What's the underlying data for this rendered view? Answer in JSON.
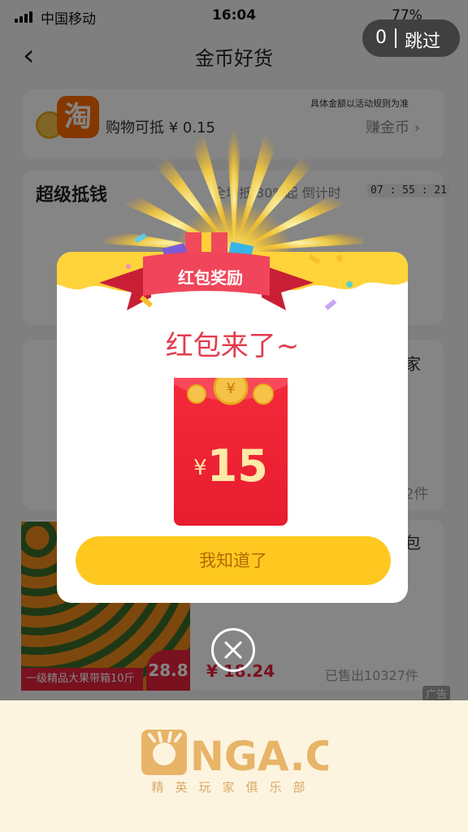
{
  "status_bar": {
    "carrier": "中国移动",
    "time": "16:04",
    "battery": "77%"
  },
  "nav": {
    "back_glyph": "‹",
    "title": "金币好货"
  },
  "skip": {
    "count": "0",
    "label": "跳过"
  },
  "coin_card": {
    "logo_glyph": "淘",
    "rule_note": "具体金额以活动规则为准",
    "deduct_text": "购物可抵 ¥ 0.15",
    "earn_link": "赚金币 ›"
  },
  "super_deal": {
    "title": "超级抵钱",
    "promo": "全场抵 30%起",
    "countdown_label": "倒计时",
    "countdown": "07 : 55 : 21"
  },
  "product": {
    "caption": "一级精品大果带箱10斤",
    "thumb_price": "28.8",
    "price": "¥ 18.24",
    "sold": "已售出10327件"
  },
  "right_peek": [
    "家",
    "2件",
    "包"
  ],
  "ad_label": "广告",
  "modal": {
    "ribbon_text": "红包奖励",
    "title": "红包来了~",
    "currency": "¥",
    "amount": "15",
    "confirm_label": "我知道了",
    "close_glyph": "×"
  },
  "footer": {
    "logo_text": "NGA.CN",
    "slogan": "精英玩家俱乐部"
  },
  "colors": {
    "accent_red": "#e23c4d",
    "button_yellow": "#ffc820",
    "envelope_red": "#e81d30",
    "coin_gold": "#f6c34a"
  }
}
